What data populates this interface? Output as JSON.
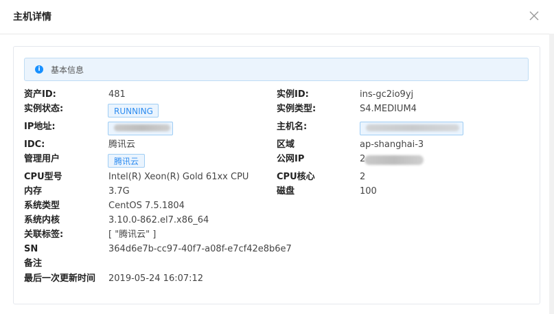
{
  "dialog": {
    "title": "主机详情"
  },
  "alert": {
    "text": "基本信息"
  },
  "fields": {
    "asset_id": {
      "label": "资产ID:",
      "value": "481"
    },
    "instance_id": {
      "label": "实例ID:",
      "value": "ins-gc2io9yj"
    },
    "instance_status": {
      "label": "实例状态:",
      "value": "RUNNING"
    },
    "instance_type": {
      "label": "实例类型:",
      "value": "S4.MEDIUM4"
    },
    "ip": {
      "label": "IP地址:",
      "value": ""
    },
    "hostname": {
      "label": "主机名:",
      "value": ""
    },
    "idc": {
      "label": "IDC:",
      "value": "腾讯云"
    },
    "region": {
      "label": "区域",
      "value": "ap-shanghai-3"
    },
    "admin_user": {
      "label": "管理用户",
      "value": "腾讯云"
    },
    "public_ip": {
      "label": "公网IP",
      "value": "2"
    },
    "cpu_model": {
      "label": "CPU型号",
      "value": "Intel(R) Xeon(R) Gold 61xx CPU"
    },
    "cpu_cores": {
      "label": "CPU核心",
      "value": "2"
    },
    "memory": {
      "label": "内存",
      "value": "3.7G"
    },
    "disk": {
      "label": "磁盘",
      "value": "100"
    },
    "os_type": {
      "label": "系统类型",
      "value": "CentOS 7.5.1804"
    },
    "kernel": {
      "label": "系统内核",
      "value": "3.10.0-862.el7.x86_64"
    },
    "tags": {
      "label": "关联标签:",
      "value": "[ \"腾讯云\" ]"
    },
    "sn": {
      "label": "SN",
      "value": "364d6e7b-cc97-40f7-a08f-e7cf42e8b6e7"
    },
    "remark": {
      "label": "备注",
      "value": ""
    },
    "last_update": {
      "label": "最后一次更新时间",
      "value": "2019-05-24 16:07:12"
    }
  },
  "icons": {
    "close": "close-icon",
    "info": "info-icon"
  },
  "colors": {
    "accent": "#2d8cf0",
    "alert_bg": "#ebf4fd",
    "tag_border": "#9fcdf4"
  }
}
